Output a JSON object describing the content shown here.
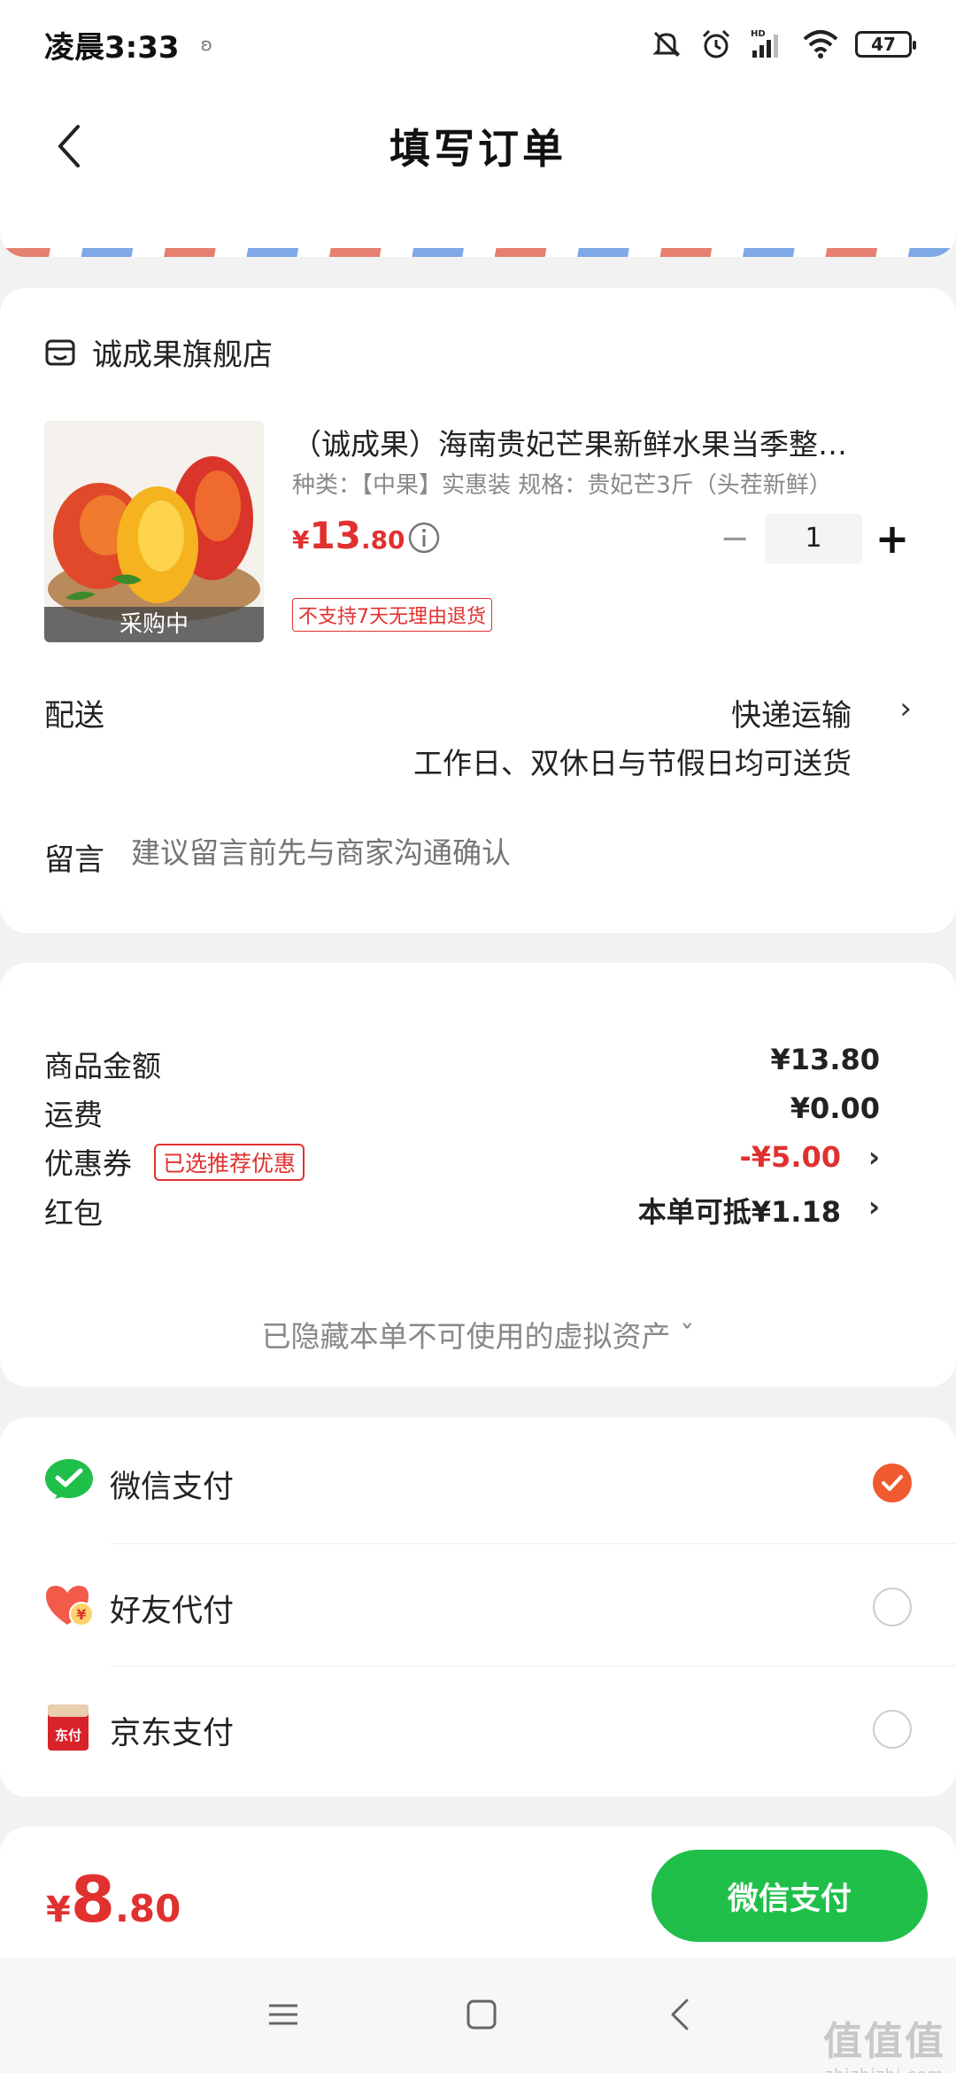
{
  "status_bar": {
    "time": "凌晨3:33",
    "extra": "ʚ",
    "network": "HD",
    "battery": "47"
  },
  "nav": {
    "title": "填写订单"
  },
  "store": {
    "name": "诚成果旗舰店"
  },
  "product": {
    "title": "（诚成果）海南贵妃芒果新鲜水果当季整…",
    "spec": "种类：【中果】实惠装   规格：贵妃芒3斤（头茬新鲜）",
    "price_currency": "¥",
    "price_int": "13",
    "price_dec": ".80",
    "purchasing_label": "采购中",
    "return_policy": "不支持7天无理由退货",
    "quantity": "1",
    "minus_glyph": "−",
    "plus_glyph": "+"
  },
  "delivery": {
    "label": "配送",
    "value": "快递运输",
    "sub": "工作日、双休日与节假日均可送货",
    "chevron": "›"
  },
  "remark": {
    "label": "留言",
    "placeholder": "建议留言前先与商家沟通确认"
  },
  "amounts": {
    "goods_label": "商品金额",
    "goods_value": "¥13.80",
    "shipping_label": "运费",
    "shipping_value": "¥0.00",
    "coupon_label": "优惠券",
    "coupon_tag": "已选推荐优惠",
    "coupon_value": "-¥5.00",
    "redpacket_label": "红包",
    "redpacket_value": "本单可抵¥1.18",
    "chevron": "›",
    "hidden_assets": "已隐藏本单不可使用的虚拟资产 ˇ"
  },
  "payment": {
    "methods": [
      {
        "label": "微信支付",
        "icon": "wechat-pay-icon",
        "selected": true
      },
      {
        "label": "好友代付",
        "icon": "friend-pay-icon",
        "selected": false
      },
      {
        "label": "京东支付",
        "icon": "jd-pay-icon",
        "selected": false
      }
    ],
    "jd_icon_text": "东付"
  },
  "bottom": {
    "total_currency": "¥",
    "total_int": "8",
    "total_dec": ".80",
    "pay_button": "微信支付"
  },
  "watermark": {
    "big": "值值值",
    "small": "zhizhizhi.com"
  },
  "colors": {
    "accent_red": "#e0312f",
    "wechat_green": "#1fbf4a",
    "radio_checked": "#ef5a2f"
  }
}
